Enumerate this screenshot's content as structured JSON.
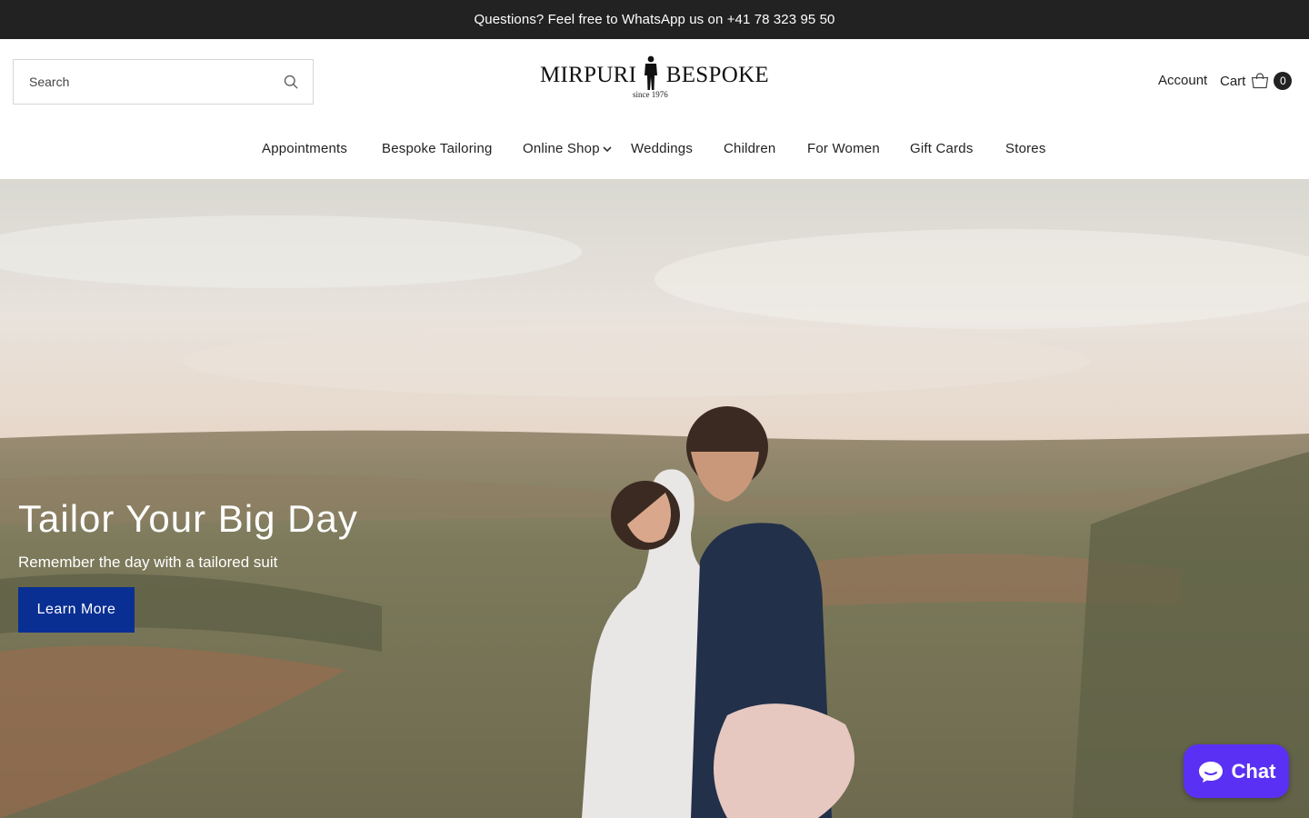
{
  "announcement": {
    "text": "Questions? Feel free to WhatsApp us on +41 78 323 95 50"
  },
  "header": {
    "search_placeholder": "Search",
    "logo": {
      "left": "MIRPURI",
      "right": "BESPOKE",
      "since": "since 1976"
    },
    "account_label": "Account",
    "cart_label": "Cart",
    "cart_count": "0"
  },
  "nav": {
    "items": [
      {
        "label": "Appointments"
      },
      {
        "label": "Bespoke Tailoring"
      },
      {
        "label": "Online Shop",
        "has_dropdown": true
      },
      {
        "label": "Weddings"
      },
      {
        "label": "Children"
      },
      {
        "label": "For Women"
      },
      {
        "label": "Gift Cards"
      },
      {
        "label": "Stores"
      }
    ]
  },
  "hero": {
    "title": "Tailor Your Big Day",
    "subtitle": "Remember the day with a tailored suit",
    "button_label": "Learn More"
  },
  "chat": {
    "label": "Chat"
  },
  "colors": {
    "announcement_bg": "#222222",
    "button_bg": "#0a2f93",
    "chat_bg": "#5a31f4"
  },
  "icons": [
    "search-icon",
    "cart-icon",
    "chevron-down-icon",
    "chat-icon"
  ]
}
